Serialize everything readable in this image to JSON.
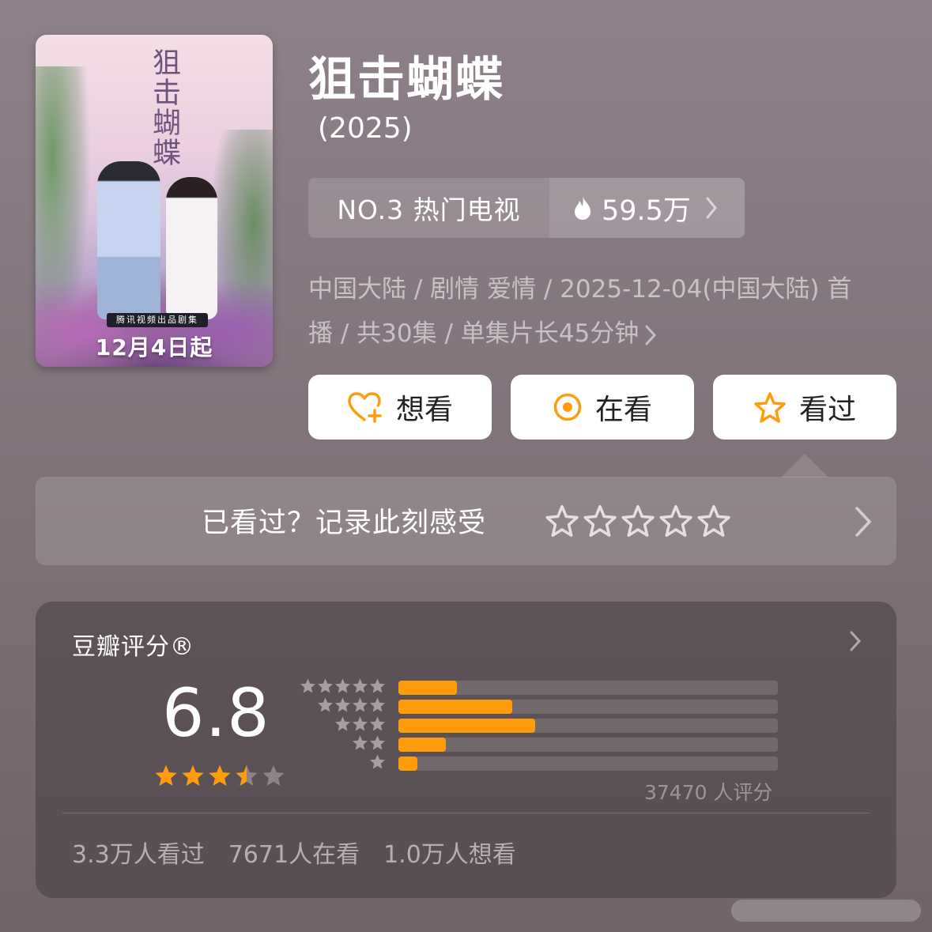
{
  "poster": {
    "title_art": "狙击蝴蝶",
    "banner": "腾讯视频出品剧集",
    "date": "12月4日起"
  },
  "title": "狙击蝴蝶",
  "year": "(2025)",
  "rank": {
    "text": "NO.3 热门电视",
    "heat": "59.5万"
  },
  "meta": {
    "line1": "中国大陆 / 剧情 爱情 / 2025-12-04(中国大陆) 首",
    "line2": "播 / 共30集 / 单集片长45分钟"
  },
  "buttons": {
    "want": "想看",
    "watching": "在看",
    "watched": "看过"
  },
  "record": {
    "prompt": "已看过？记录此刻感受",
    "stars": 5
  },
  "rating": {
    "label": "豆瓣评分®",
    "score": "6.8",
    "stars": 3.5,
    "distribution": [
      {
        "stars": 5,
        "fraction": 0.155
      },
      {
        "stars": 4,
        "fraction": 0.3
      },
      {
        "stars": 3,
        "fraction": 0.36
      },
      {
        "stars": 2,
        "fraction": 0.125
      },
      {
        "stars": 1,
        "fraction": 0.05
      }
    ],
    "count": "37470 人评分"
  },
  "stats": {
    "watched": "3.3万人看过",
    "watching": "7671人在看",
    "want": "1.0万人想看"
  },
  "colors": {
    "accent": "#ff9c0c",
    "heart": "#ff9c0c"
  }
}
